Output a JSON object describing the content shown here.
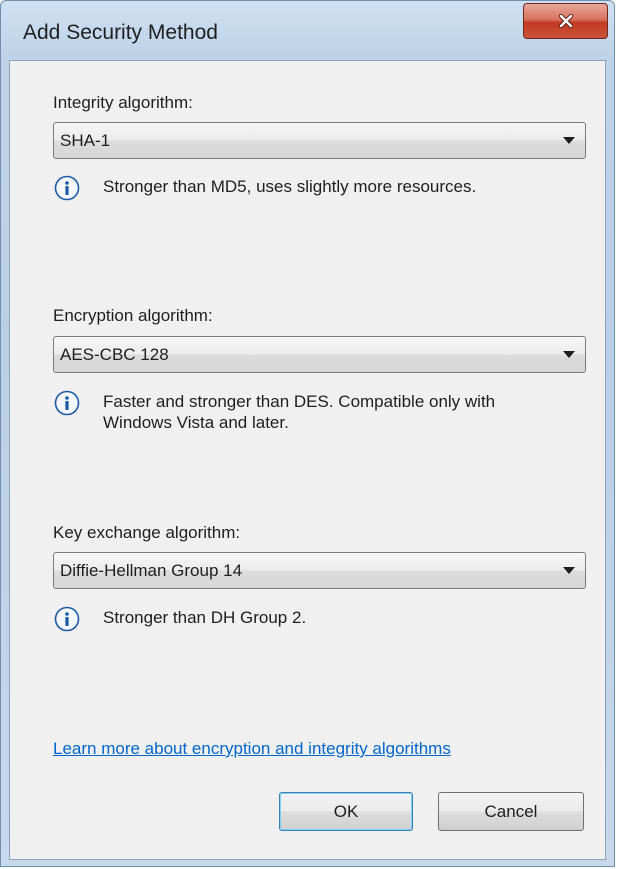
{
  "window": {
    "title": "Add Security Method"
  },
  "integrity": {
    "label": "Integrity algorithm:",
    "value": "SHA-1",
    "info": "Stronger than MD5, uses slightly more resources."
  },
  "encryption": {
    "label": "Encryption algorithm:",
    "value": "AES-CBC 128",
    "info": "Faster and stronger than DES. Compatible only with Windows Vista and later."
  },
  "key_exchange": {
    "label": "Key exchange algorithm:",
    "value": "Diffie-Hellman Group 14",
    "info": "Stronger than DH Group 2."
  },
  "link": {
    "text": "Learn more about encryption and integrity algorithms"
  },
  "buttons": {
    "ok": "OK",
    "cancel": "Cancel"
  },
  "icons": {
    "close": "close-icon",
    "info": "info-icon",
    "dropdown": "chevron-down-icon"
  },
  "colors": {
    "link": "#0066cc",
    "close_button": "#c23a22",
    "info_icon": "#1c5aa6"
  }
}
